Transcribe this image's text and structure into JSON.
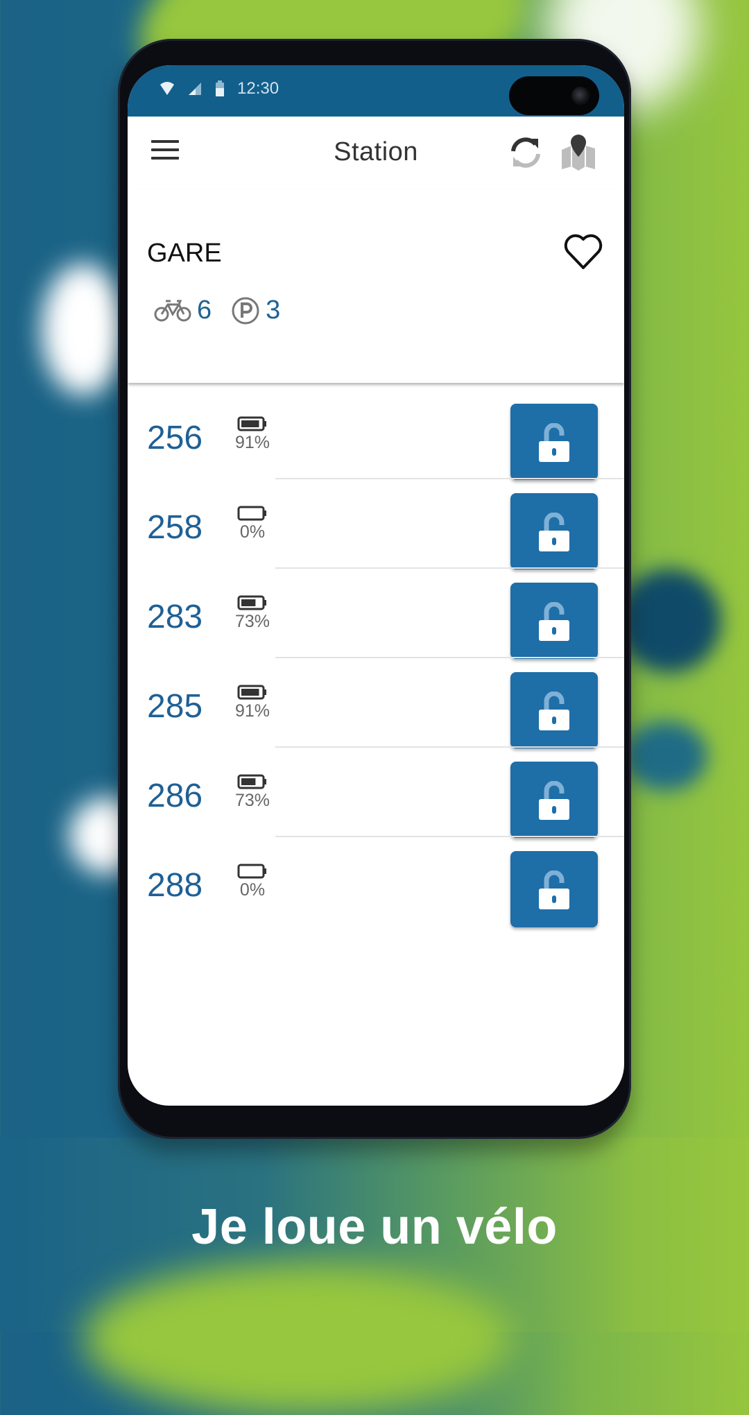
{
  "status_bar": {
    "time": "12:30",
    "icons": [
      "wifi-icon",
      "signal-icon",
      "battery-icon"
    ]
  },
  "app_bar": {
    "title": "Station",
    "menu_icon": "hamburger-menu-icon",
    "actions": [
      {
        "name": "refresh",
        "icon": "refresh-icon"
      },
      {
        "name": "map",
        "icon": "map-pin-icon"
      }
    ]
  },
  "station": {
    "name": "GARE",
    "favorite_icon": "heart-outline-icon",
    "bikes_available": "6",
    "parking_available": "3"
  },
  "bikes": [
    {
      "number": "256",
      "battery_percent": 91,
      "battery_label": "91%"
    },
    {
      "number": "258",
      "battery_percent": 0,
      "battery_label": "0%"
    },
    {
      "number": "283",
      "battery_percent": 73,
      "battery_label": "73%"
    },
    {
      "number": "285",
      "battery_percent": 91,
      "battery_label": "91%"
    },
    {
      "number": "286",
      "battery_percent": 73,
      "battery_label": "73%"
    },
    {
      "number": "288",
      "battery_percent": 0,
      "battery_label": "0%"
    }
  ],
  "unlock_icon": "unlock-padlock-icon",
  "caption": "Je loue un vélo",
  "colors": {
    "primary": "#1e6ea8",
    "status_bar": "#135f8c",
    "number_text": "#1f6095",
    "background_left": "#1b6286",
    "background_right": "#96c63e"
  }
}
